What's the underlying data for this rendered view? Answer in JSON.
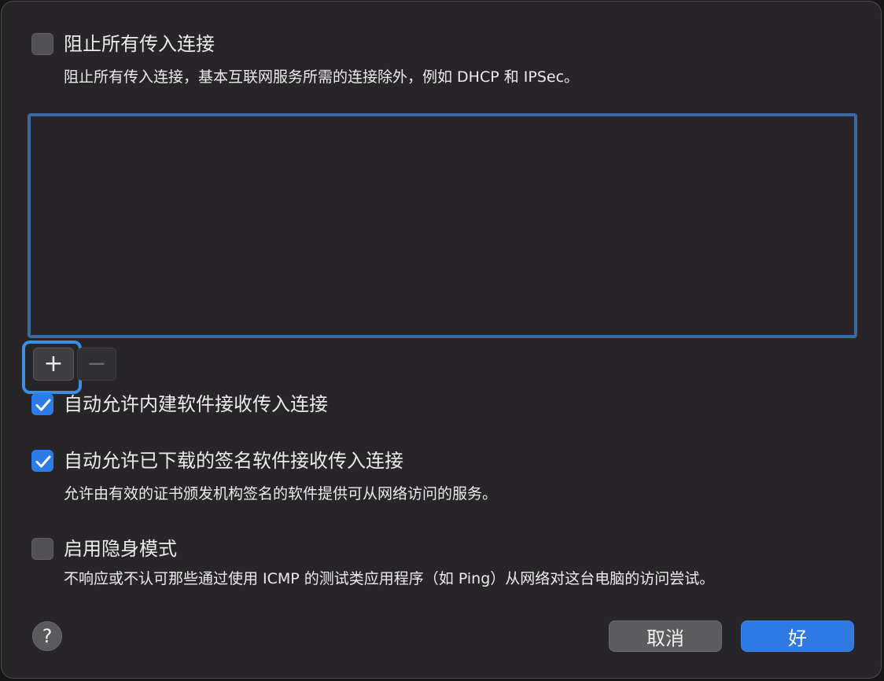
{
  "options": {
    "block_all": {
      "label": "阻止所有传入连接",
      "description": "阻止所有传入连接，基本互联网服务所需的连接除外，例如 DHCP 和 IPSec。",
      "checked": false
    },
    "auto_allow_builtin": {
      "label": "自动允许内建软件接收传入连接",
      "checked": true
    },
    "auto_allow_signed": {
      "label": "自动允许已下载的签名软件接收传入连接",
      "description": "允许由有效的证书颁发机构签名的软件提供可从网络访问的服务。",
      "checked": true
    },
    "stealth_mode": {
      "label": "启用隐身模式",
      "description": "不响应或不认可那些通过使用 ICMP 的测试类应用程序（如 Ping）从网络对这台电脑的访问尝试。",
      "checked": false
    }
  },
  "app_list": {
    "items": [],
    "add_label": "+",
    "remove_label": "−"
  },
  "footer": {
    "help_label": "?",
    "cancel_label": "取消",
    "ok_label": "好"
  },
  "colors": {
    "accent": "#2f79e3",
    "background": "#272528",
    "list_border": "#3a6aa0"
  }
}
